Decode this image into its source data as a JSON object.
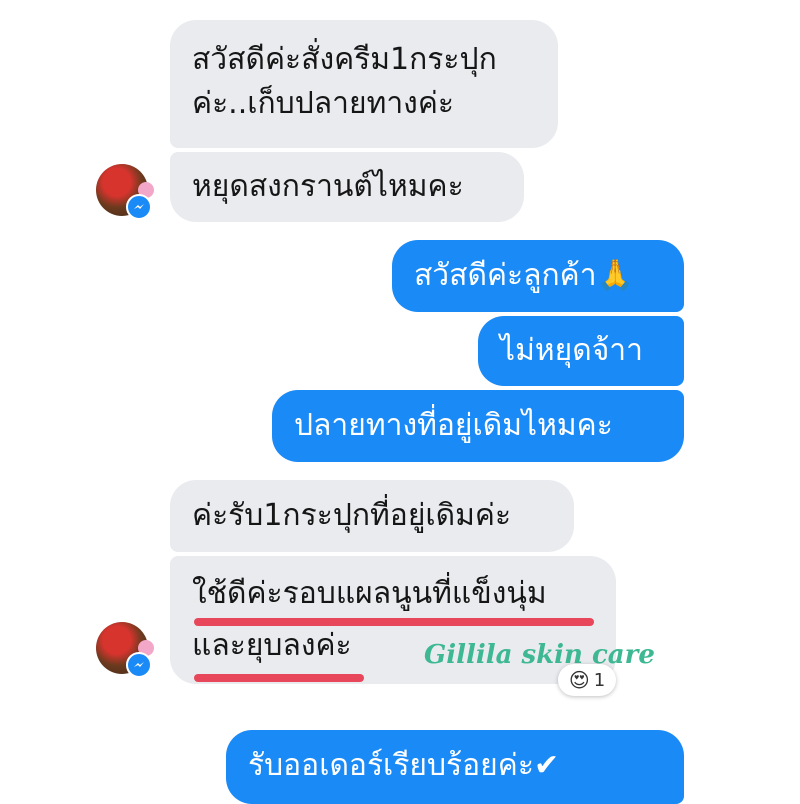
{
  "messages": {
    "in1_line1": "สวัสดีค่ะสั่งครีม1กระปุก",
    "in1_line2": "ค่ะ..เก็บปลายทางค่ะ",
    "in2": "หยุดสงกรานต์ไหมคะ",
    "out1": "สวัสดีค่ะลูกค้า🙏",
    "out2": "ไม่หยุดจ้าา",
    "out3": "ปลายทางที่อยู่เดิมไหมคะ",
    "in3": "ค่ะรับ1กระปุกที่อยู่เดิมค่ะ",
    "in4_line1": "ใช้ดีค่ะรอบแผลนูนที่แข็งนุ่ม",
    "in4_line2": "และยุบลงค่ะ",
    "out4": "รับออเดอร์เรียบร้อยค่ะ✔"
  },
  "watermark": "Gillila skin care",
  "reaction": {
    "emoji": "😍",
    "count": "1"
  },
  "icons": {
    "messenger_badge": "messenger-icon",
    "reaction": "heart-eyes-emoji"
  },
  "colors": {
    "incoming_bubble": "#e9ebef",
    "outgoing_bubble": "#1a8af7",
    "underline": "#e8465a",
    "watermark": "#3db893"
  }
}
